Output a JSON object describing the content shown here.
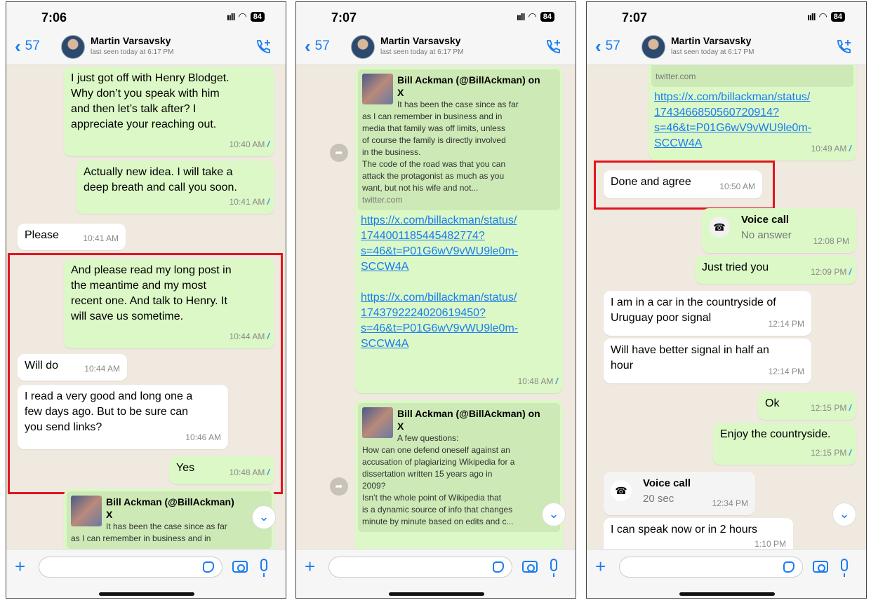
{
  "status": {
    "time1": "7:06",
    "time2": "7:07",
    "time3": "7:07",
    "battery": "84"
  },
  "contact": {
    "back_count": "57",
    "name": "Martin Varsavsky",
    "last_seen": "last seen today at 6:17 PM"
  },
  "screen1": {
    "msg1": {
      "lines": [
        "I just got off with Henry Blodget.",
        "Why don’t you speak with him",
        "and then let’s talk after? I",
        "appreciate your reaching out."
      ],
      "time": "10:40 AM"
    },
    "msg2": {
      "lines": [
        "Actually new idea. I will take a",
        "deep breath and call you soon."
      ],
      "time": "10:41 AM"
    },
    "msg3": {
      "text": "Please",
      "time": "10:41 AM"
    },
    "msg4": {
      "lines": [
        "And please read my long post in",
        "the meantime and my most",
        "recent one. And talk to Henry. It",
        "will save us sometime."
      ],
      "time": "10:44 AM"
    },
    "msg5": {
      "text": "Will do",
      "time": "10:44 AM"
    },
    "msg6": {
      "lines": [
        "I read a very good and long one a",
        "few days ago. But to be sure can",
        "you send links?"
      ],
      "time": "10:46 AM"
    },
    "msg7": {
      "text": "Yes",
      "time": "10:48 AM"
    },
    "preview": {
      "title1": "Bill Ackman (@BillAckman)",
      "title2": "X",
      "line1": "It has been the case since as far",
      "line2": "as I can remember in business and in"
    }
  },
  "screen2": {
    "preview1": {
      "title1": "Bill Ackman (@BillAckman) on",
      "title2": "X",
      "line1": "It has been the case since as far",
      "body": [
        "as I can remember in business and in",
        "media that family was off limits, unless",
        "of course the family is directly involved",
        "in the business.",
        "The code of the road was that you can",
        "attack the protagonist as much as you",
        "want, but not his wife and not..."
      ],
      "domain": "twitter.com"
    },
    "link1": [
      "https://x.com/billackman/status/",
      "1744001185445482774?",
      "s=46&t=P01G6wV9vWU9le0m-",
      "SCCW4A"
    ],
    "link2": [
      "https://x.com/billackman/status/",
      "1743792224020619450?",
      "s=46&t=P01G6wV9vWU9le0m-",
      "SCCW4A"
    ],
    "time": "10:48 AM",
    "preview2": {
      "title1": "Bill Ackman (@BillAckman) on",
      "title2": "X",
      "line1": "A few questions:",
      "body": [
        "How can one defend oneself against an",
        "accusation of plagiarizing Wikipedia for a",
        "dissertation written 15 years ago in",
        "2009?",
        "Isn’t the whole point of Wikipedia that",
        "is a dynamic source of info that changes",
        "minute by minute based on edits and c..."
      ]
    }
  },
  "screen3": {
    "domain": "twitter.com",
    "link": [
      "https://x.com/billackman/status/",
      "1743466850560720914?",
      "s=46&t=P01G6wV9vWU9le0m-",
      "SCCW4A"
    ],
    "link_time": "10:49 AM",
    "done": {
      "text": "Done and agree",
      "time": "10:50 AM"
    },
    "call1": {
      "title": "Voice call",
      "sub": "No answer",
      "time": "12:08 PM"
    },
    "tried": {
      "text": "Just tried you",
      "time": "12:09 PM"
    },
    "car": {
      "lines": [
        "I am in a car in the countryside of",
        "Uruguay poor signal"
      ],
      "time": "12:14 PM"
    },
    "better": {
      "lines": [
        "Will have better signal in half an",
        "hour"
      ],
      "time": "12:14 PM"
    },
    "ok": {
      "text": "Ok",
      "time": "12:15 PM"
    },
    "enjoy": {
      "text": "Enjoy the countryside.",
      "time": "12:15 PM"
    },
    "call2": {
      "title": "Voice call",
      "sub": "20 sec",
      "time": "12:34 PM"
    },
    "speak": {
      "text": "I can speak now or  in 2 hours",
      "time": "1:10 PM"
    }
  }
}
